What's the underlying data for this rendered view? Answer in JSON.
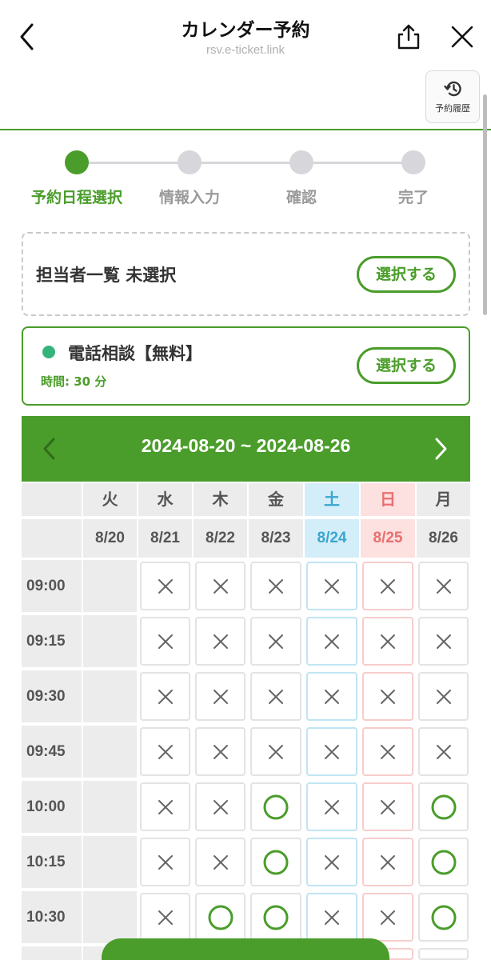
{
  "header": {
    "title": "カレンダー予約",
    "url": "rsv.e-ticket.link"
  },
  "history_button": {
    "label": "予約履歴",
    "icon": "history-icon"
  },
  "stepper": {
    "steps": [
      {
        "label": "予約日程選択",
        "active": true
      },
      {
        "label": "情報入力",
        "active": false
      },
      {
        "label": "確認",
        "active": false
      },
      {
        "label": "完了",
        "active": false
      }
    ]
  },
  "staff": {
    "text": "担当者一覧 未選択",
    "button_label": "選択する"
  },
  "service": {
    "name": "電話相談【無料】",
    "duration": "時間: 30 分",
    "button_label": "選択する"
  },
  "calendar": {
    "range": "2024-08-20 ~ 2024-08-26",
    "days": [
      {
        "weekday": "火",
        "date": "8/20",
        "type": ""
      },
      {
        "weekday": "水",
        "date": "8/21",
        "type": ""
      },
      {
        "weekday": "木",
        "date": "8/22",
        "type": ""
      },
      {
        "weekday": "金",
        "date": "8/23",
        "type": ""
      },
      {
        "weekday": "土",
        "date": "8/24",
        "type": "sat"
      },
      {
        "weekday": "日",
        "date": "8/25",
        "type": "sun"
      },
      {
        "weekday": "月",
        "date": "8/26",
        "type": ""
      }
    ],
    "slots": [
      {
        "time": "09:00",
        "status": [
          "",
          "x",
          "x",
          "x",
          "x",
          "x",
          "x"
        ]
      },
      {
        "time": "09:15",
        "status": [
          "",
          "x",
          "x",
          "x",
          "x",
          "x",
          "x"
        ]
      },
      {
        "time": "09:30",
        "status": [
          "",
          "x",
          "x",
          "x",
          "x",
          "x",
          "x"
        ]
      },
      {
        "time": "09:45",
        "status": [
          "",
          "x",
          "x",
          "x",
          "x",
          "x",
          "x"
        ]
      },
      {
        "time": "10:00",
        "status": [
          "",
          "x",
          "x",
          "o",
          "x",
          "x",
          "o"
        ]
      },
      {
        "time": "10:15",
        "status": [
          "",
          "x",
          "x",
          "o",
          "x",
          "x",
          "o"
        ]
      },
      {
        "time": "10:30",
        "status": [
          "",
          "x",
          "o",
          "o",
          "x",
          "x",
          "o"
        ]
      }
    ]
  },
  "colors": {
    "accent": "#4a9d2a",
    "saturday": "#3aa6cf",
    "sunday": "#ea6f6f",
    "service_dot": "#34b47a"
  }
}
